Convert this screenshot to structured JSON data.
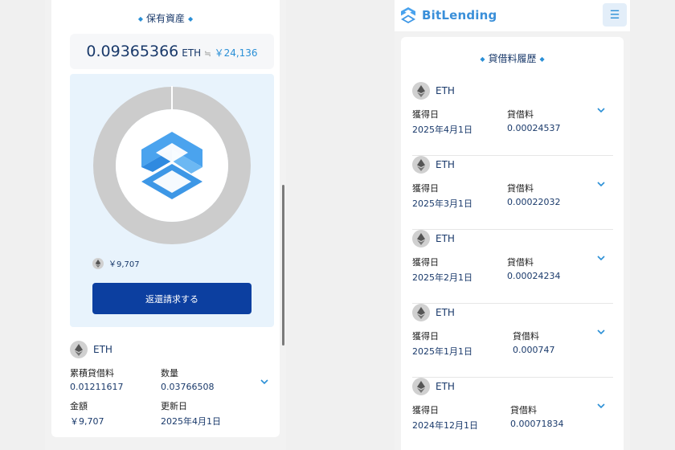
{
  "left": {
    "section_title": "保有資産",
    "total": {
      "eth": "0.09365366",
      "unit": "ETH",
      "approx": "≒",
      "jpy": "￥24,136"
    },
    "legend_value": "￥9,707",
    "claim_button": "返還請求する",
    "holding": {
      "coin": "ETH",
      "fields": [
        {
          "label": "累積貸借料",
          "value": "0.01211617"
        },
        {
          "label": "数量",
          "value": "0.03766508"
        },
        {
          "label": "金額",
          "value": "￥9,707"
        },
        {
          "label": "更新日",
          "value": "2025年4月1日"
        }
      ]
    },
    "donut": {
      "segments": [
        {
          "value": 100,
          "color": "#cccccc"
        }
      ],
      "ring_color": "#cccccc",
      "gap_color": "#ffffff"
    }
  },
  "right": {
    "brand": "BitLending",
    "section_title": "貸借料履歴",
    "history": [
      {
        "coin": "ETH",
        "date_label": "獲得日",
        "date": "2025年4月1日",
        "fee_label": "貸借料",
        "fee": "0.00024537"
      },
      {
        "coin": "ETH",
        "date_label": "獲得日",
        "date": "2025年3月1日",
        "fee_label": "貸借料",
        "fee": "0.00022032"
      },
      {
        "coin": "ETH",
        "date_label": "獲得日",
        "date": "2025年2月1日",
        "fee_label": "貸借料",
        "fee": "0.00024234"
      },
      {
        "coin": "ETH",
        "date_label": "獲得日",
        "date": "2025年1月1日",
        "fee_label": "貸借料",
        "fee": "0.000747"
      },
      {
        "coin": "ETH",
        "date_label": "獲得日",
        "date": "2024年12月1日",
        "fee_label": "貸借料",
        "fee": "0.00071834"
      }
    ]
  },
  "icons": {
    "menu": "hamburger-icon",
    "expand": "chevron-down-icon",
    "coin": "ethereum-icon",
    "logo": "bitlending-logo-icon"
  },
  "colors": {
    "accent": "#2a8fd6",
    "button": "#0c3fa0",
    "navy_text": "#1a3a6b",
    "chart_bg": "#e8f3fc"
  }
}
